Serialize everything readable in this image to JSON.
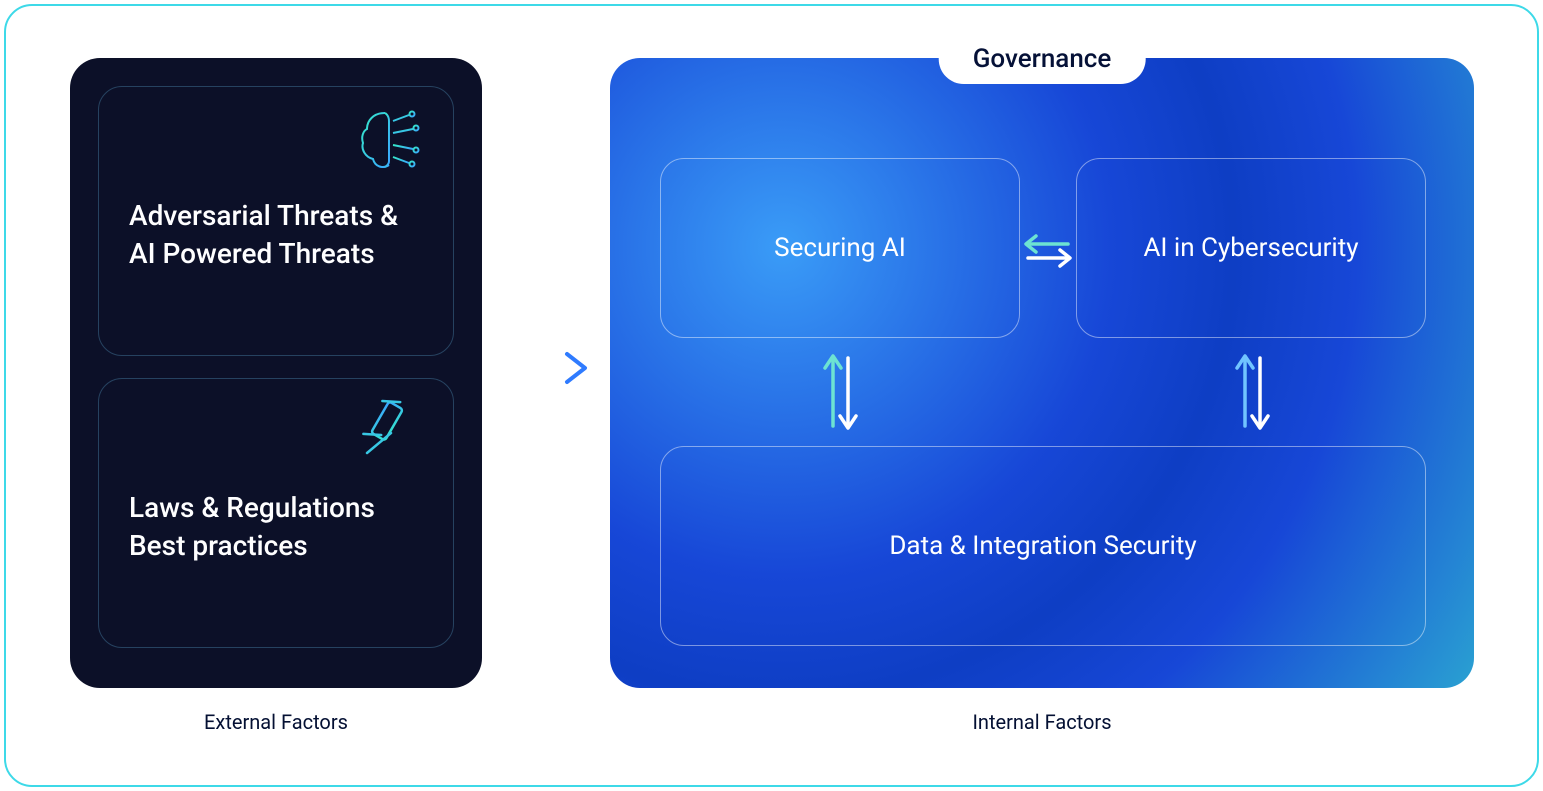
{
  "external": {
    "label": "External Factors",
    "cards": [
      {
        "title": "Adversarial Threats & AI Powered Threats"
      },
      {
        "title": "Laws & Regulations Best practices"
      }
    ]
  },
  "governance_badge": "Governance",
  "internal": {
    "label": "Internal Factors",
    "securing_ai": "Securing AI",
    "ai_in_cyber": "AI in Cybersecurity",
    "data_integration": "Data & Integration Security"
  }
}
